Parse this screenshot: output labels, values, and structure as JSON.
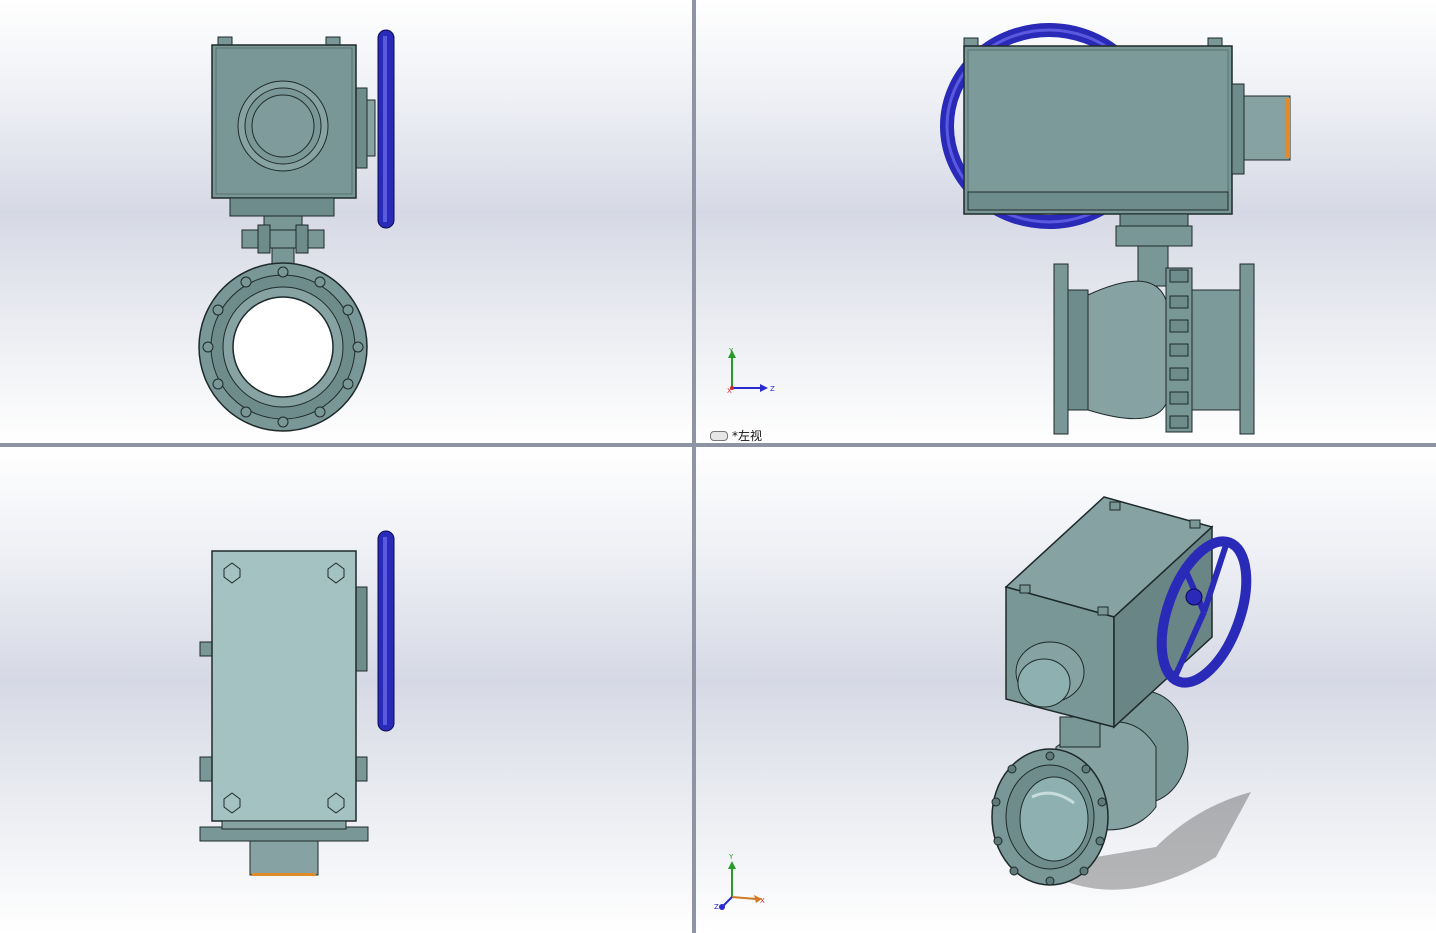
{
  "window": {
    "layout": "four-viewport"
  },
  "viewports": {
    "top_left": {
      "view": "front"
    },
    "top_right": {
      "view": "left",
      "label": "*左视",
      "triad": {
        "y": "Y",
        "x": "X",
        "z": "Z"
      }
    },
    "bottom_left": {
      "view": "top"
    },
    "bottom_right": {
      "view": "isometric",
      "triad": {
        "y": "Y",
        "x": "X",
        "z": "Z"
      }
    }
  },
  "colors": {
    "body": "#7a9797",
    "body_light": "#a4bcbc",
    "body_dark": "#3e5050",
    "handwheel": "#2a2ab8",
    "outline": "#1e2a2a",
    "accent_orange": "#e08a2a"
  },
  "icons": {
    "view_icon": "view-link-icon"
  }
}
